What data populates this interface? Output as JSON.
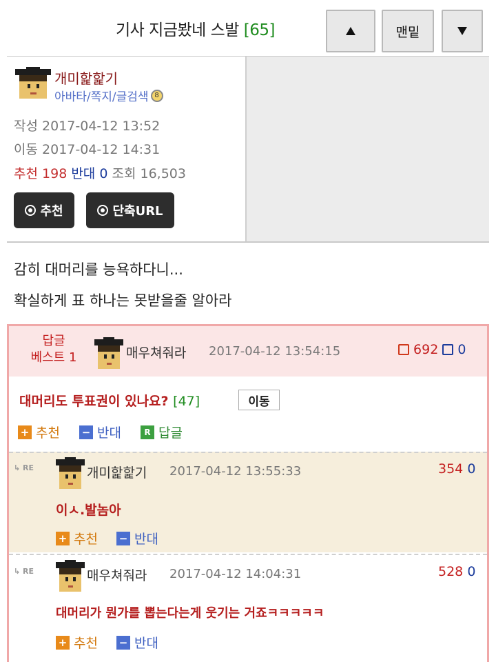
{
  "header": {
    "title": "기사 지금봤네 스발",
    "count": "[65]",
    "end_label": "맨밑"
  },
  "author": {
    "name": "개미핥핥기",
    "links": "아바타/쪽지/글검색",
    "created_label": "작성",
    "created": "2017-04-12 13:52",
    "moved_label": "이동",
    "moved": "2017-04-12 14:31",
    "rec_label": "추천",
    "rec_count": "198",
    "opp_label": "반대",
    "opp_count": "0",
    "views_label": "조회",
    "views": "16,503",
    "rec_button": "추천",
    "url_button": "단축URL"
  },
  "post": {
    "lines": [
      "감히 대머리를 능욕하다니...",
      "확실하게 표 하나는 못받을줄 알아라"
    ]
  },
  "best_reply": {
    "label_line1": "답글",
    "label_line2": "베스트 1",
    "nick": "매우쳐줘라",
    "date": "2017-04-12 13:54:15",
    "up": "692",
    "down": "0",
    "text": "대머리도 투표권이 있나요?",
    "count": "[47]",
    "move_label": "이동",
    "rec_label": "추천",
    "opp_label": "반대",
    "reply_label": "답글"
  },
  "sub_replies": [
    {
      "re": "RE",
      "nick": "개미핥핥기",
      "date": "2017-04-12 13:55:33",
      "up": "354",
      "down": "0",
      "text": "이ㅅ.발놈아",
      "rec_label": "추천",
      "opp_label": "반대"
    },
    {
      "re": "RE",
      "nick": "매우쳐줘라",
      "date": "2017-04-12 14:04:31",
      "up": "528",
      "down": "0",
      "text": "대머리가 뭔가를 뽑는다는게 웃기는 거죠ㅋㅋㅋㅋㅋ",
      "rec_label": "추천",
      "opp_label": "반대"
    }
  ],
  "colors": {
    "recommend": "#c43030",
    "oppose": "#1c3c9c",
    "count_green": "#1f8c1f",
    "best_border": "#f0a8a8"
  }
}
